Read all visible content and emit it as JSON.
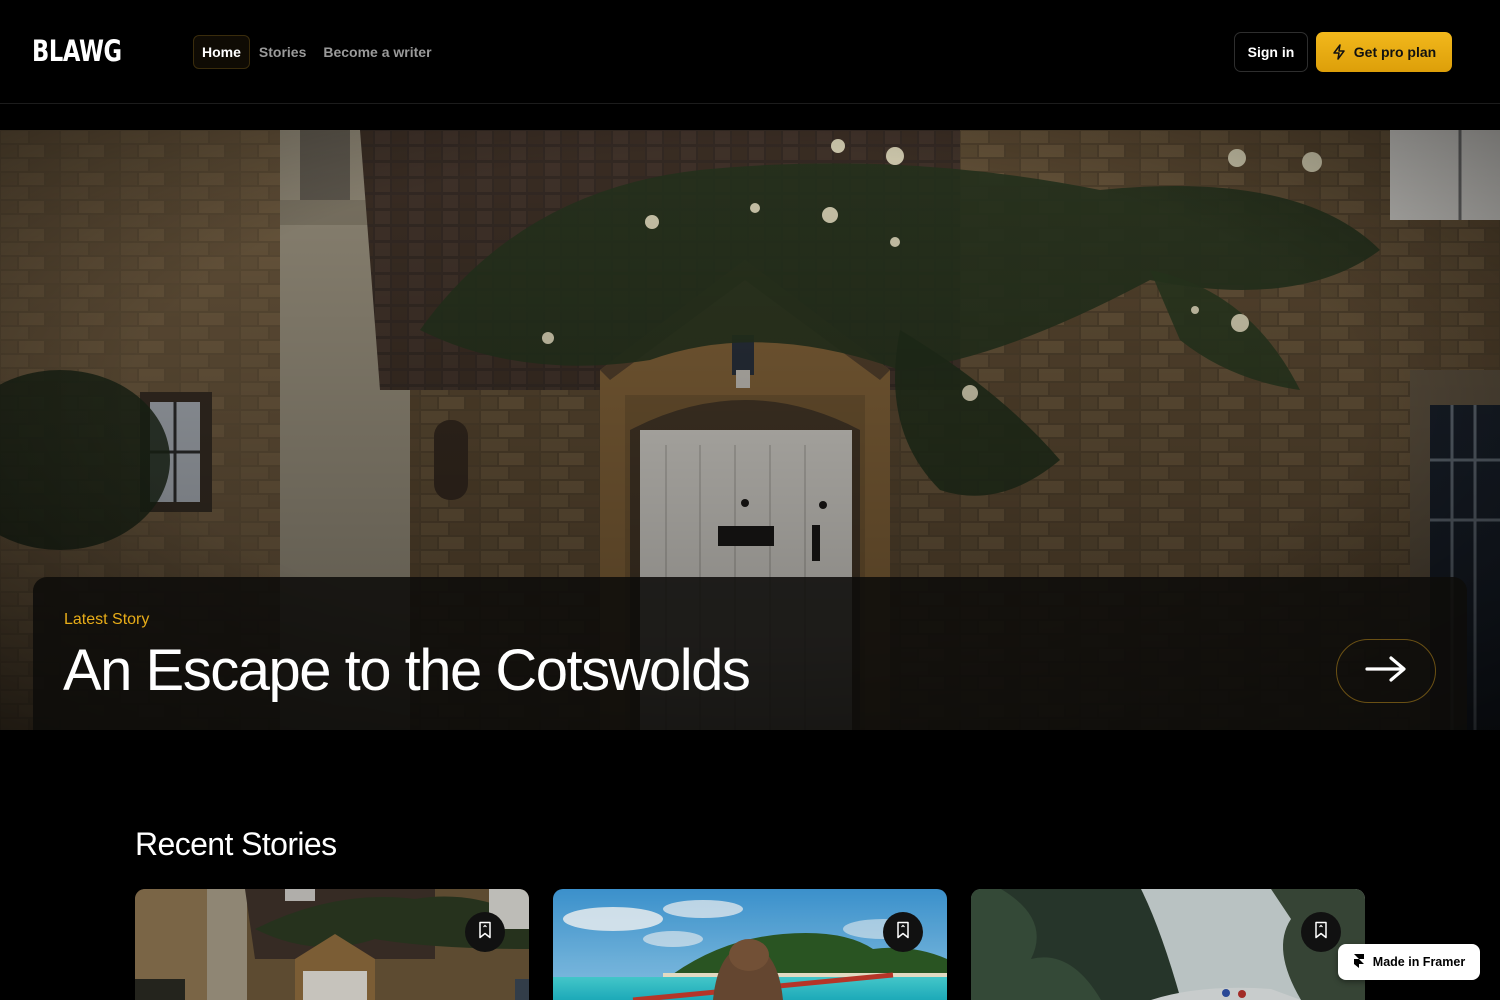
{
  "header": {
    "logo": "BLAWG",
    "nav": [
      {
        "label": "Home",
        "active": true
      },
      {
        "label": "Stories",
        "active": false
      },
      {
        "label": "Become a writer",
        "active": false
      }
    ],
    "sign_in_label": "Sign in",
    "pro_label": "Get pro plan",
    "pro_icon": "lightning-icon"
  },
  "hero": {
    "tag": "Latest Story",
    "title": "An Escape to the Cotswolds",
    "arrow_icon": "arrow-right-icon",
    "image": "stone cottage with climbing roses"
  },
  "recent": {
    "title": "Recent Stories",
    "cards": [
      {
        "image": "stone cottage",
        "bookmark_icon": "bookmark-icon"
      },
      {
        "image": "kayaking on turquoise sea",
        "bookmark_icon": "bookmark-icon"
      },
      {
        "image": "green rocky cliffs",
        "bookmark_icon": "bookmark-icon"
      }
    ]
  },
  "badge": {
    "label": "Made in Framer",
    "icon": "framer-icon"
  },
  "colors": {
    "accent": "#e7ac18",
    "background": "#000000"
  }
}
